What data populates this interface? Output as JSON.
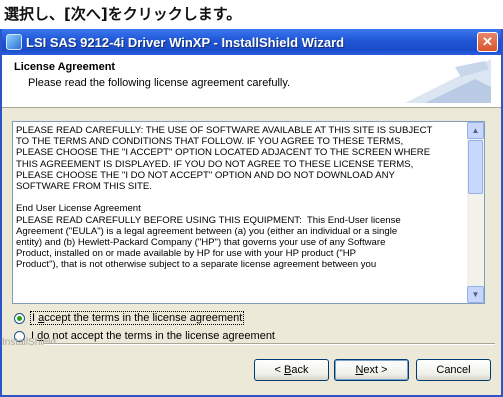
{
  "caption": {
    "text": "選択し、[次へ]をクリックします。"
  },
  "window": {
    "title": "LSI SAS 9212-4i Driver WinXP - InstallShield Wizard",
    "close_glyph": "✕"
  },
  "header": {
    "title": "License Agreement",
    "subtitle": "Please read the following license agreement carefully."
  },
  "license": {
    "text": "PLEASE READ CAREFULLY: THE USE OF SOFTWARE AVAILABLE AT THIS SITE IS SUBJECT\nTO THE TERMS AND CONDITIONS THAT FOLLOW. IF YOU AGREE TO THESE TERMS,\nPLEASE CHOOSE THE \"I ACCEPT\" OPTION LOCATED ADJACENT TO THE SCREEN WHERE\nTHIS AGREEMENT IS DISPLAYED. IF YOU DO NOT AGREE TO THESE LICENSE TERMS,\nPLEASE CHOOSE THE \"I DO NOT ACCEPT\" OPTION AND DO NOT DOWNLOAD ANY\nSOFTWARE FROM THIS SITE.\n\nEnd User License Agreement\nPLEASE READ CAREFULLY BEFORE USING THIS EQUIPMENT:  This End-User license\nAgreement (\"EULA\") is a legal agreement between (a) you (either an individual or a single\nentity) and (b) Hewlett-Packard Company (\"HP\") that governs your use of any Software\nProduct, installed on or made available by HP for use with your HP product (\"HP\nProduct\"), that is not otherwise subject to a separate license agreement between you",
    "scroll_up": "▲",
    "scroll_down": "▼"
  },
  "options": {
    "accept": {
      "prefix": "I ",
      "accel": "a",
      "rest": "ccept the terms in the license agreement",
      "selected": true
    },
    "decline": {
      "prefix": "I ",
      "accel": "d",
      "rest": "o not accept the terms in the license agreement",
      "selected": false
    }
  },
  "brand": "InstallShield",
  "buttons": {
    "back": {
      "prefix": "< ",
      "accel": "B",
      "rest": "ack"
    },
    "next": {
      "prefix": "",
      "accel": "N",
      "rest": "ext >"
    },
    "cancel": {
      "label": "Cancel"
    }
  },
  "colors": {
    "titlebar": "#1f55d6",
    "face": "#ece9d8",
    "radio_dot": "#21a121"
  }
}
